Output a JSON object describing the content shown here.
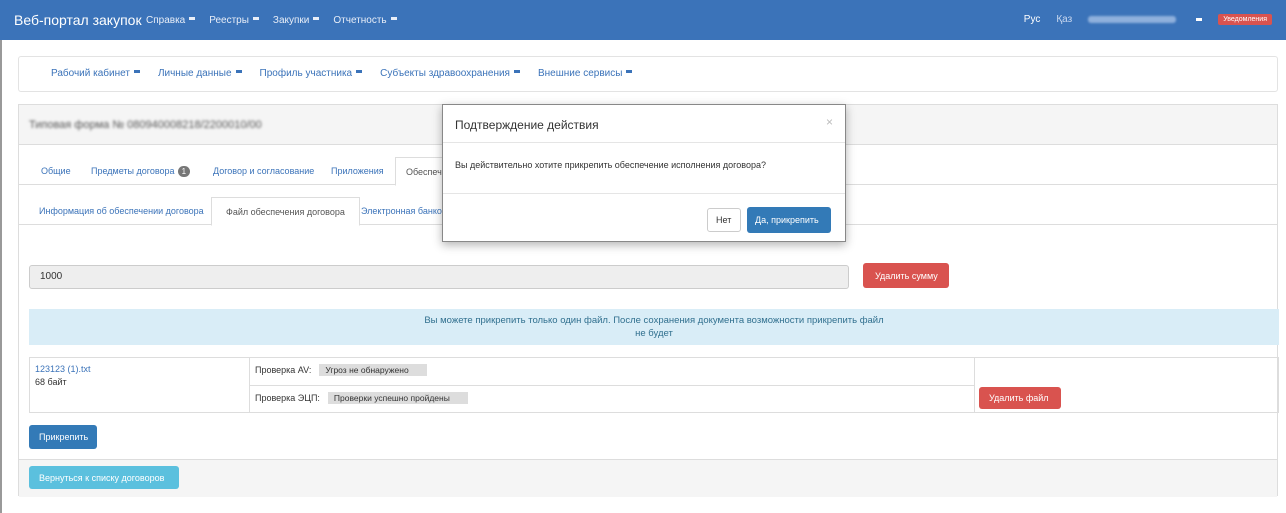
{
  "topbar": {
    "brand": "Веб-портал закупок",
    "menu": [
      "Справка",
      "Реестры",
      "Закупки",
      "Отчетность"
    ],
    "lang_ru": "Рус",
    "lang_kz": "Қаз",
    "notifications": "Уведомления"
  },
  "subnav": [
    "Рабочий кабинет",
    "Личные данные",
    "Профиль участника",
    "Субъекты здравоохранения",
    "Внешние сервисы"
  ],
  "panel": {
    "title": "Типовая форма № 080940008218/2200010/00"
  },
  "tabs": {
    "general": "Общие",
    "subjects": "Предметы договора",
    "subjects_count": "1",
    "contract": "Договор и согласование",
    "attachments": "Приложения",
    "security": "Обеспече"
  },
  "subtabs": {
    "info": "Информация об обеспечении договора",
    "file": "Файл обеспечения договора",
    "bank": "Электронная банковс"
  },
  "amount": {
    "value": "1000",
    "delete_label": "Удалить сумму"
  },
  "alert": {
    "text": "Вы можете прикрепить только один файл. После сохранения документа возможности прикрепить файл не будет"
  },
  "file": {
    "name": "123123 (1).txt",
    "size": "68 байт",
    "av_label": "Проверка AV:",
    "av_status": "Угроз не обнаружено",
    "sign_label": "Проверка ЭЦП:",
    "sign_status": "Проверки успешно пройдены",
    "delete_label": "Удалить файл"
  },
  "attach_label": "Прикрепить",
  "back_label": "Вернуться к списку договоров",
  "modal": {
    "title": "Подтверждение действия",
    "close": "×",
    "body": "Вы действительно хотите прикрепить обеспечение исполнения договора?",
    "no_label": "Нет",
    "yes_label": "Да, прикрепить"
  }
}
